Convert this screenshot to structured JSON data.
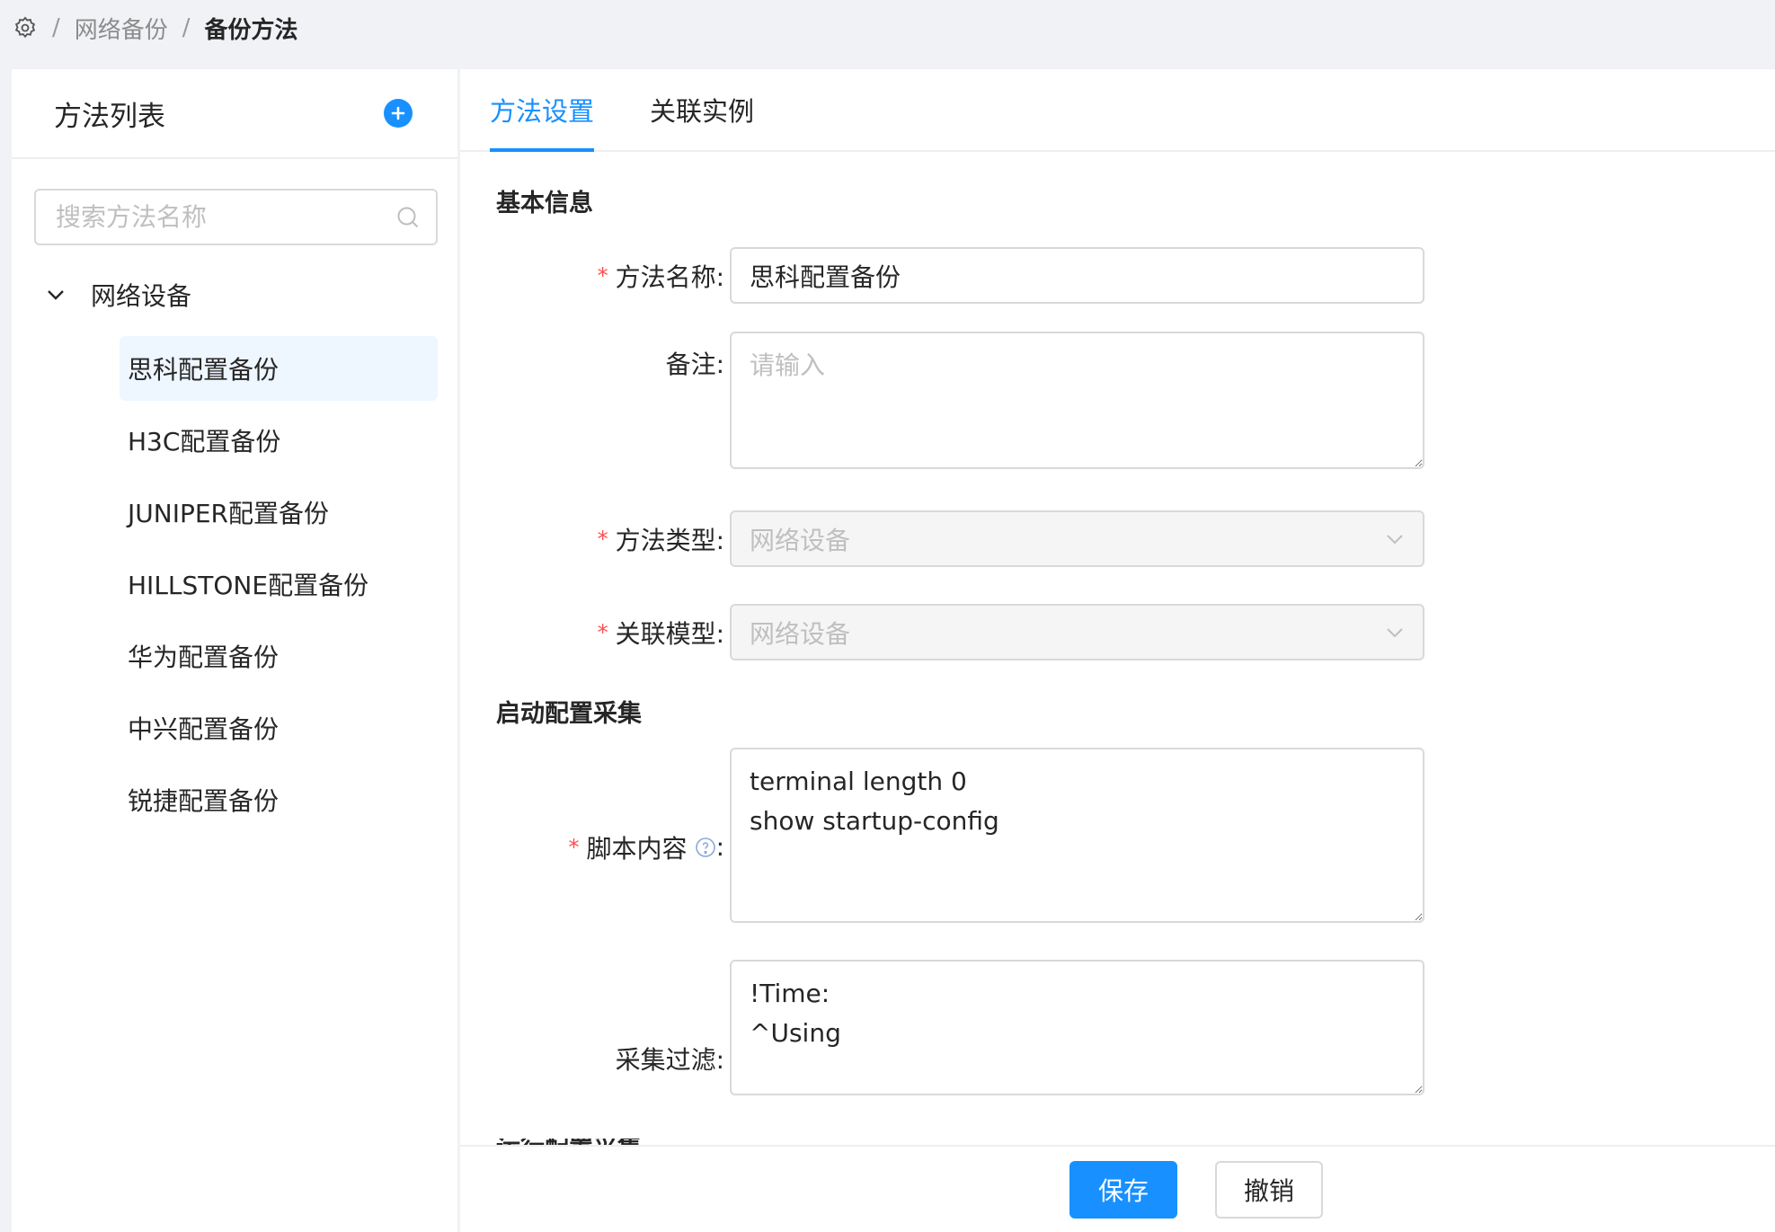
{
  "breadcrumb": {
    "home_icon": "settings-icon",
    "items": [
      "网络备份",
      "备份方法"
    ]
  },
  "sidebar": {
    "title": "方法列表",
    "add_icon": "plus-circle-icon",
    "search_placeholder": "搜索方法名称",
    "tree_root": "网络设备",
    "items": [
      {
        "label": "思科配置备份",
        "active": true
      },
      {
        "label": "H3C配置备份"
      },
      {
        "label": "JUNIPER配置备份"
      },
      {
        "label": "HILLSTONE配置备份"
      },
      {
        "label": "华为配置备份"
      },
      {
        "label": "中兴配置备份"
      },
      {
        "label": "锐捷配置备份"
      }
    ]
  },
  "tabs": [
    {
      "label": "方法设置",
      "active": true
    },
    {
      "label": "关联实例"
    }
  ],
  "form": {
    "section_basic": "基本信息",
    "method_name_label": "方法名称:",
    "method_name_value": "思科配置备份",
    "remark_label": "备注:",
    "remark_placeholder": "请输入",
    "method_type_label": "方法类型:",
    "method_type_value": "网络设备",
    "model_label": "关联模型:",
    "model_value": "网络设备",
    "section_startup": "启动配置采集",
    "script_label": "脚本内容",
    "script_value": "terminal length 0\nshow startup-config",
    "filter_label": "采集过滤:",
    "filter_value": "!Time:\n^Using",
    "section_running_cut": "运行配置采集"
  },
  "footer": {
    "save_label": "保存",
    "cancel_label": "撤销"
  },
  "colors": {
    "accent": "#1890ff",
    "required": "#ff4d4f",
    "active_item_bg": "#eef6ff"
  }
}
